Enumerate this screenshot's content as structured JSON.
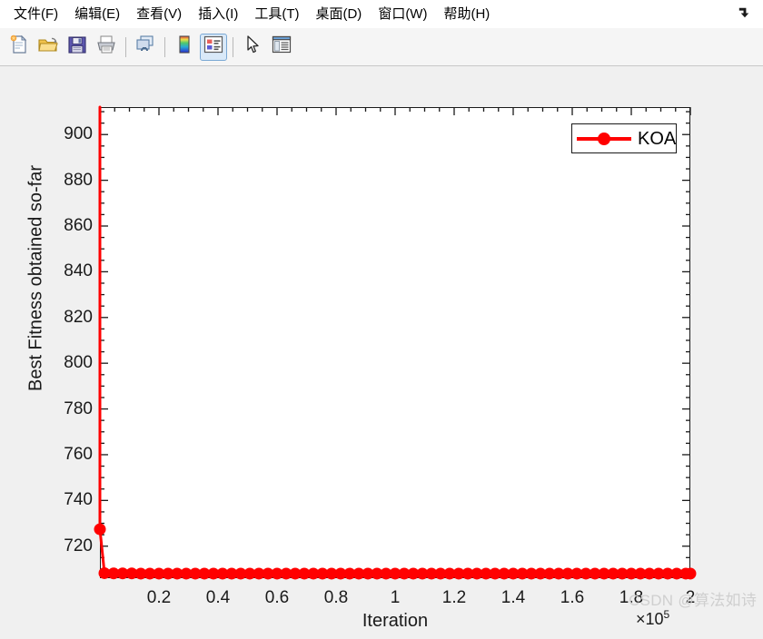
{
  "window": {
    "menu_items": [
      {
        "label": "文件(F)",
        "name": "menu-file"
      },
      {
        "label": "编辑(E)",
        "name": "menu-edit"
      },
      {
        "label": "查看(V)",
        "name": "menu-view"
      },
      {
        "label": "插入(I)",
        "name": "menu-insert"
      },
      {
        "label": "工具(T)",
        "name": "menu-tools"
      },
      {
        "label": "桌面(D)",
        "name": "menu-desktop"
      },
      {
        "label": "窗口(W)",
        "name": "menu-window"
      },
      {
        "label": "帮助(H)",
        "name": "menu-help"
      }
    ],
    "dock_icon": "dock-arrow-icon"
  },
  "toolbar": {
    "buttons": [
      {
        "icon": "new-figure-icon",
        "active": false
      },
      {
        "icon": "open-folder-icon",
        "active": false
      },
      {
        "icon": "save-icon",
        "active": false
      },
      {
        "icon": "print-icon",
        "active": false
      },
      {
        "icon": "link-plot-icon",
        "active": false
      },
      {
        "icon": "colorbar-icon",
        "active": false
      },
      {
        "icon": "legend-icon",
        "active": true
      },
      {
        "icon": "edit-plot-pointer-icon",
        "active": false
      },
      {
        "icon": "property-inspector-icon",
        "active": false
      }
    ]
  },
  "chart_data": {
    "type": "line",
    "title": "",
    "xlabel": "Iteration",
    "ylabel": "Best Fitness obtained so-far",
    "x_exponent": "×10",
    "x_exponent_power": "5",
    "xlim": [
      0,
      2
    ],
    "ylim": [
      706,
      912
    ],
    "xticks": [
      0.2,
      0.4,
      0.6,
      0.8,
      1,
      1.2,
      1.4,
      1.6,
      1.8,
      2
    ],
    "xtick_labels": [
      "0.2",
      "0.4",
      "0.6",
      "0.8",
      "1",
      "1.2",
      "1.4",
      "1.6",
      "1.8",
      "2"
    ],
    "yticks": [
      720,
      740,
      760,
      780,
      800,
      820,
      840,
      860,
      880,
      900
    ],
    "ytick_labels": [
      "720",
      "740",
      "760",
      "780",
      "800",
      "820",
      "840",
      "860",
      "880",
      "900"
    ],
    "grid": false,
    "legend_position": "top-right",
    "series": [
      {
        "name": "KOA",
        "color": "#ff0000",
        "marker": "circle",
        "marker_size": 13,
        "line_width": 3,
        "x": [
          0,
          0.0154,
          0.0462,
          0.0769,
          0.1077,
          0.1385,
          0.1692,
          0.2,
          0.2308,
          0.2615,
          0.2923,
          0.3231,
          0.3538,
          0.3846,
          0.4154,
          0.4462,
          0.4769,
          0.5077,
          0.5385,
          0.5692,
          0.6,
          0.6308,
          0.6615,
          0.6923,
          0.7231,
          0.7538,
          0.7846,
          0.8154,
          0.8462,
          0.8769,
          0.9077,
          0.9385,
          0.9692,
          1.0,
          1.0308,
          1.0615,
          1.0923,
          1.1231,
          1.1538,
          1.1846,
          1.2154,
          1.2462,
          1.2769,
          1.3077,
          1.3385,
          1.3692,
          1.4,
          1.4308,
          1.4615,
          1.4923,
          1.5231,
          1.5538,
          1.5846,
          1.6154,
          1.6462,
          1.6769,
          1.7077,
          1.7385,
          1.7692,
          1.8,
          1.8308,
          1.8615,
          1.8923,
          1.9231,
          1.9538,
          1.9846,
          2.0
        ],
        "y": [
          727.4,
          708.2,
          708.1,
          708.1,
          708.1,
          708.0,
          708.0,
          708.0,
          708.0,
          708.0,
          708.0,
          708.0,
          708.0,
          708.0,
          708.0,
          708.0,
          708.0,
          708.0,
          708.0,
          708.0,
          708.0,
          708.0,
          708.0,
          708.0,
          708.0,
          708.0,
          708.0,
          708.0,
          708.0,
          708.0,
          708.0,
          708.0,
          708.0,
          708.0,
          708.0,
          708.0,
          708.0,
          708.0,
          708.0,
          708.0,
          708.0,
          708.0,
          708.0,
          708.0,
          708.0,
          708.0,
          708.0,
          708.0,
          708.0,
          708.0,
          708.0,
          708.0,
          708.0,
          708.0,
          708.0,
          708.0,
          708.0,
          708.0,
          708.0,
          708.0,
          708.0,
          708.0,
          708.0,
          708.0,
          708.0,
          708.0,
          708.0
        ],
        "initial_offscale_y": 912,
        "note": "curve enters from above the top of the y-axis at x=0 and drops vertically to the first plotted marker"
      }
    ],
    "legend": [
      {
        "label": "KOA",
        "color": "#ff0000",
        "marker": "circle"
      }
    ]
  },
  "watermark": {
    "text": "CSDN @算法如诗"
  }
}
